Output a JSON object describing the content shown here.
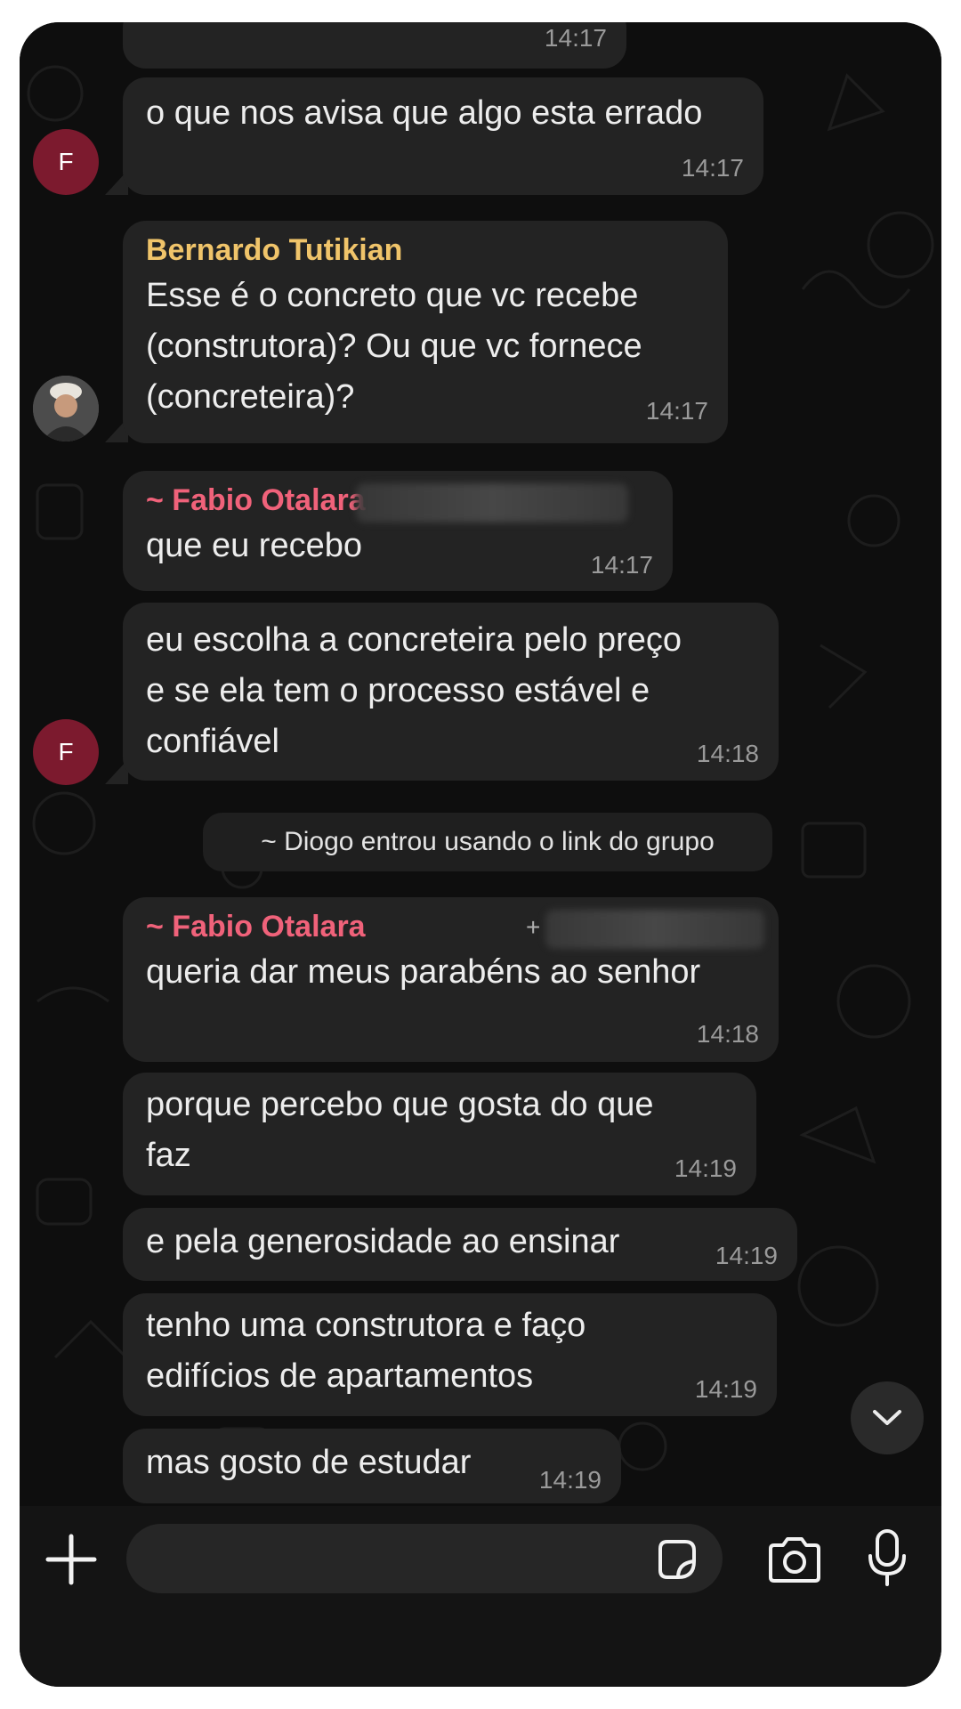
{
  "messages": [
    {
      "text": "",
      "time": "14:17"
    },
    {
      "text": "o que nos avisa que algo esta errado",
      "time": "14:17",
      "avatar": "F"
    },
    {
      "sender": "Bernardo Tutikian",
      "lines": [
        "Esse é o concreto que vc recebe",
        "(construtora)? Ou que vc fornece",
        "(concreteira)?"
      ],
      "time": "14:17"
    },
    {
      "sender": "~ Fabio Otalara",
      "text": "que eu recebo",
      "time": "14:17"
    },
    {
      "lines": [
        "eu escolha a concreteira pelo preço",
        "e se ela tem o processo estável e",
        "confiável"
      ],
      "time": "14:18",
      "avatar": "F"
    },
    {
      "sender": "~ Fabio Otalara",
      "plus": "+",
      "text": "queria dar meus parabéns ao senhor",
      "time": "14:18"
    },
    {
      "lines": [
        "porque percebo que gosta do que",
        "faz"
      ],
      "time": "14:19"
    },
    {
      "text": "e pela generosidade ao ensinar",
      "time": "14:19"
    },
    {
      "lines": [
        "tenho uma construtora e faço",
        "edifícios de apartamentos"
      ],
      "time": "14:19"
    },
    {
      "text": "mas gosto de estudar",
      "time": "14:19"
    }
  ],
  "system_notice": "~ Diogo entrou usando o link do grupo",
  "input": {
    "placeholder": ""
  },
  "icons": [
    "plus-icon",
    "sticker-icon",
    "camera-icon",
    "microphone-icon",
    "chevron-down-icon"
  ],
  "colors": {
    "bernardo_name": "#f0c46a",
    "fabio_name": "#f0627a",
    "avatar_f": "#7c1a2e",
    "bubble": "#232323"
  }
}
